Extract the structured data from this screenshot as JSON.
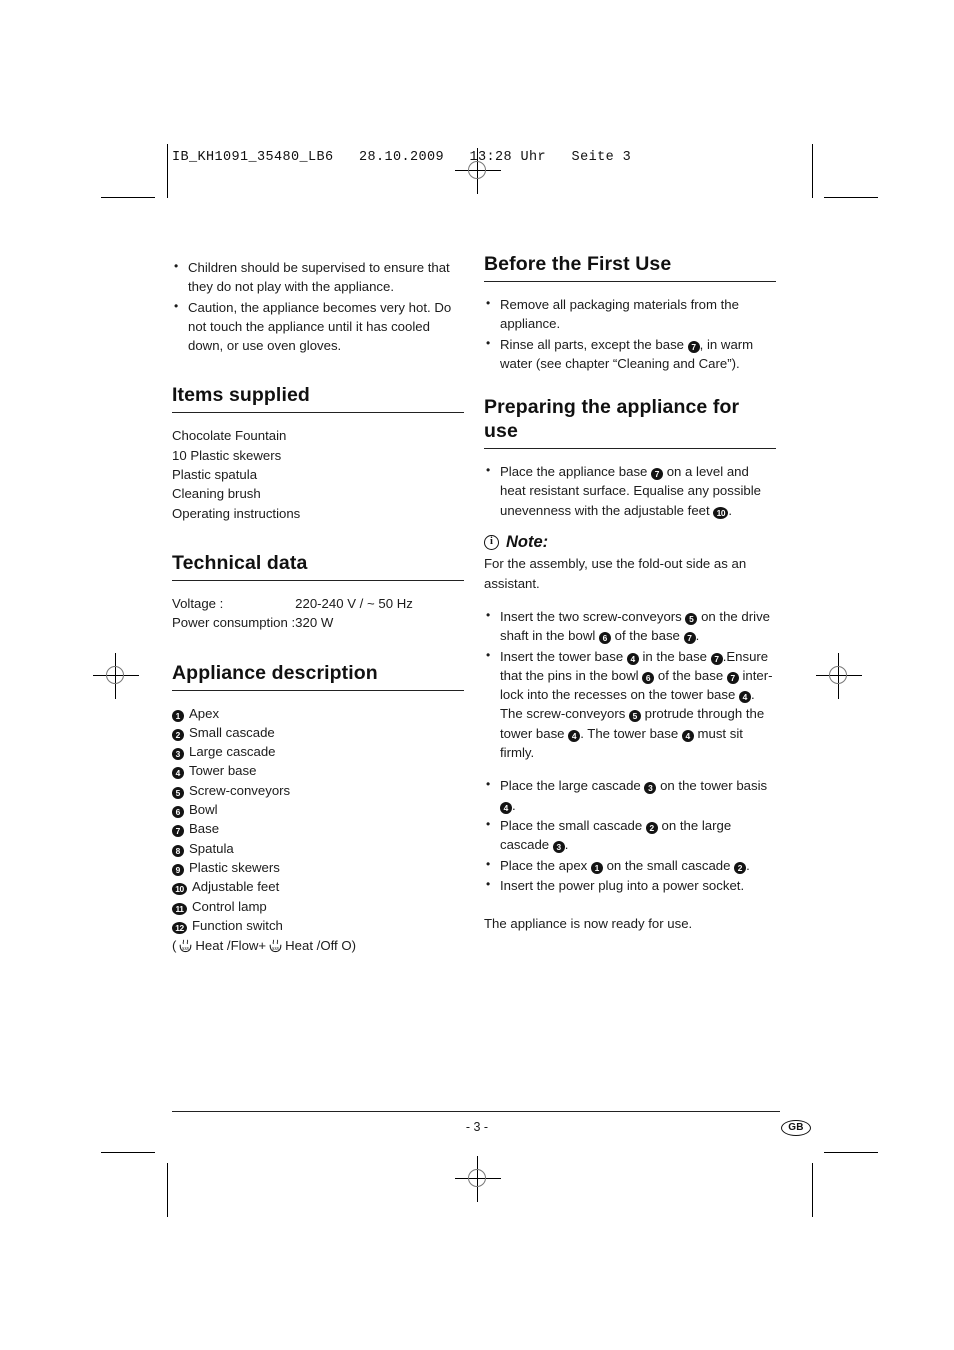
{
  "document": {
    "slug": "IB_KH1091_35480_LB6   28.10.2009   13:28 Uhr   Seite 3",
    "page_number": "- 3 -",
    "language_badge": "GB"
  },
  "left_column": {
    "intro_bullets": [
      "Children should be supervised to ensure that they do not play with the appliance.",
      "Caution, the appliance becomes very hot. Do not touch the appliance until it has cooled down, or use oven gloves."
    ],
    "items_supplied": {
      "heading": "Items supplied",
      "items": [
        "Chocolate Fountain",
        "10 Plastic skewers",
        "Plastic spatula",
        "Cleaning brush",
        "Operating instructions"
      ]
    },
    "technical_data": {
      "heading": "Technical data",
      "rows": [
        {
          "label": "Voltage :",
          "value": "220-240 V / ~ 50 Hz"
        },
        {
          "label": "Power consumption :",
          "value": "320 W"
        }
      ]
    },
    "appliance_description": {
      "heading": "Appliance description",
      "items": [
        {
          "num": "1",
          "label": "Apex"
        },
        {
          "num": "2",
          "label": "Small cascade"
        },
        {
          "num": "3",
          "label": "Large cascade"
        },
        {
          "num": "4",
          "label": "Tower base"
        },
        {
          "num": "5",
          "label": "Screw-conveyors"
        },
        {
          "num": "6",
          "label": "Bowl"
        },
        {
          "num": "7",
          "label": "Base"
        },
        {
          "num": "8",
          "label": "Spatula"
        },
        {
          "num": "9",
          "label": "Plastic skewers"
        },
        {
          "num": "10",
          "label": "Adjustable feet"
        },
        {
          "num": "11",
          "label": "Control lamp"
        },
        {
          "num": "12",
          "label": "Function switch"
        }
      ],
      "switch_line": {
        "open_paren": "(",
        "part1": "Heat /Flow+",
        "part2": "Heat /Off O)"
      }
    }
  },
  "right_column": {
    "before_first_use": {
      "heading": "Before the First Use",
      "bullets": [
        {
          "text_before": "Remove all packaging materials from the appliance.",
          "text_after": ""
        },
        {
          "text_before": "Rinse all parts, except the base ",
          "ref": "7",
          "text_after": ", in warm water (see chapter “Cleaning and Care”)."
        }
      ]
    },
    "preparing": {
      "heading": "Preparing the appliance for use",
      "bullet_1": {
        "a": "Place the appliance base ",
        "ref1": "7",
        "b": " on a level and heat resistant surface. Equalise any possible unevenness with the adjustable feet ",
        "ref2": "10",
        "c": "."
      },
      "note": {
        "icon_char": "i",
        "title": "Note:",
        "body": "For the assembly, use the fold-out side as an assistant."
      },
      "bullet_2": {
        "a": "Insert the two screw-conveyors ",
        "ref1": "5",
        "b": " on the drive shaft in the bowl ",
        "ref2": "6",
        "c": " of the base ",
        "ref3": "7",
        "d": "."
      },
      "bullet_3": {
        "a": "Insert the tower base ",
        "ref1": "4",
        "b": " in the base ",
        "ref2": "7",
        "c": ".Ensure that the pins in the bowl ",
        "ref3": "6",
        "d": " of the base ",
        "ref4": "7",
        "e": " inter-lock into the recesses on the tower base ",
        "ref5": "4",
        "f": ". The screw-conveyors ",
        "ref6": "5",
        "g": " protrude through the tower base ",
        "ref7": "4",
        "h": ". The tower base ",
        "ref8": "4",
        "i": " must sit firmly."
      },
      "bullet_4": {
        "a": "Place the large cascade ",
        "ref1": "3",
        "b": " on the tower basis ",
        "ref2": "4",
        "c": "."
      },
      "bullet_5": {
        "a": "Place the small cascade ",
        "ref1": "2",
        "b": " on the large cascade ",
        "ref2": "3",
        "c": "."
      },
      "bullet_6": {
        "a": "Place the apex ",
        "ref1": "1",
        "b": " on the small cascade ",
        "ref2": "2",
        "c": "."
      },
      "bullet_7": {
        "a": "Insert the power plug into a power socket."
      },
      "closing": "The appliance is now ready for use."
    }
  }
}
